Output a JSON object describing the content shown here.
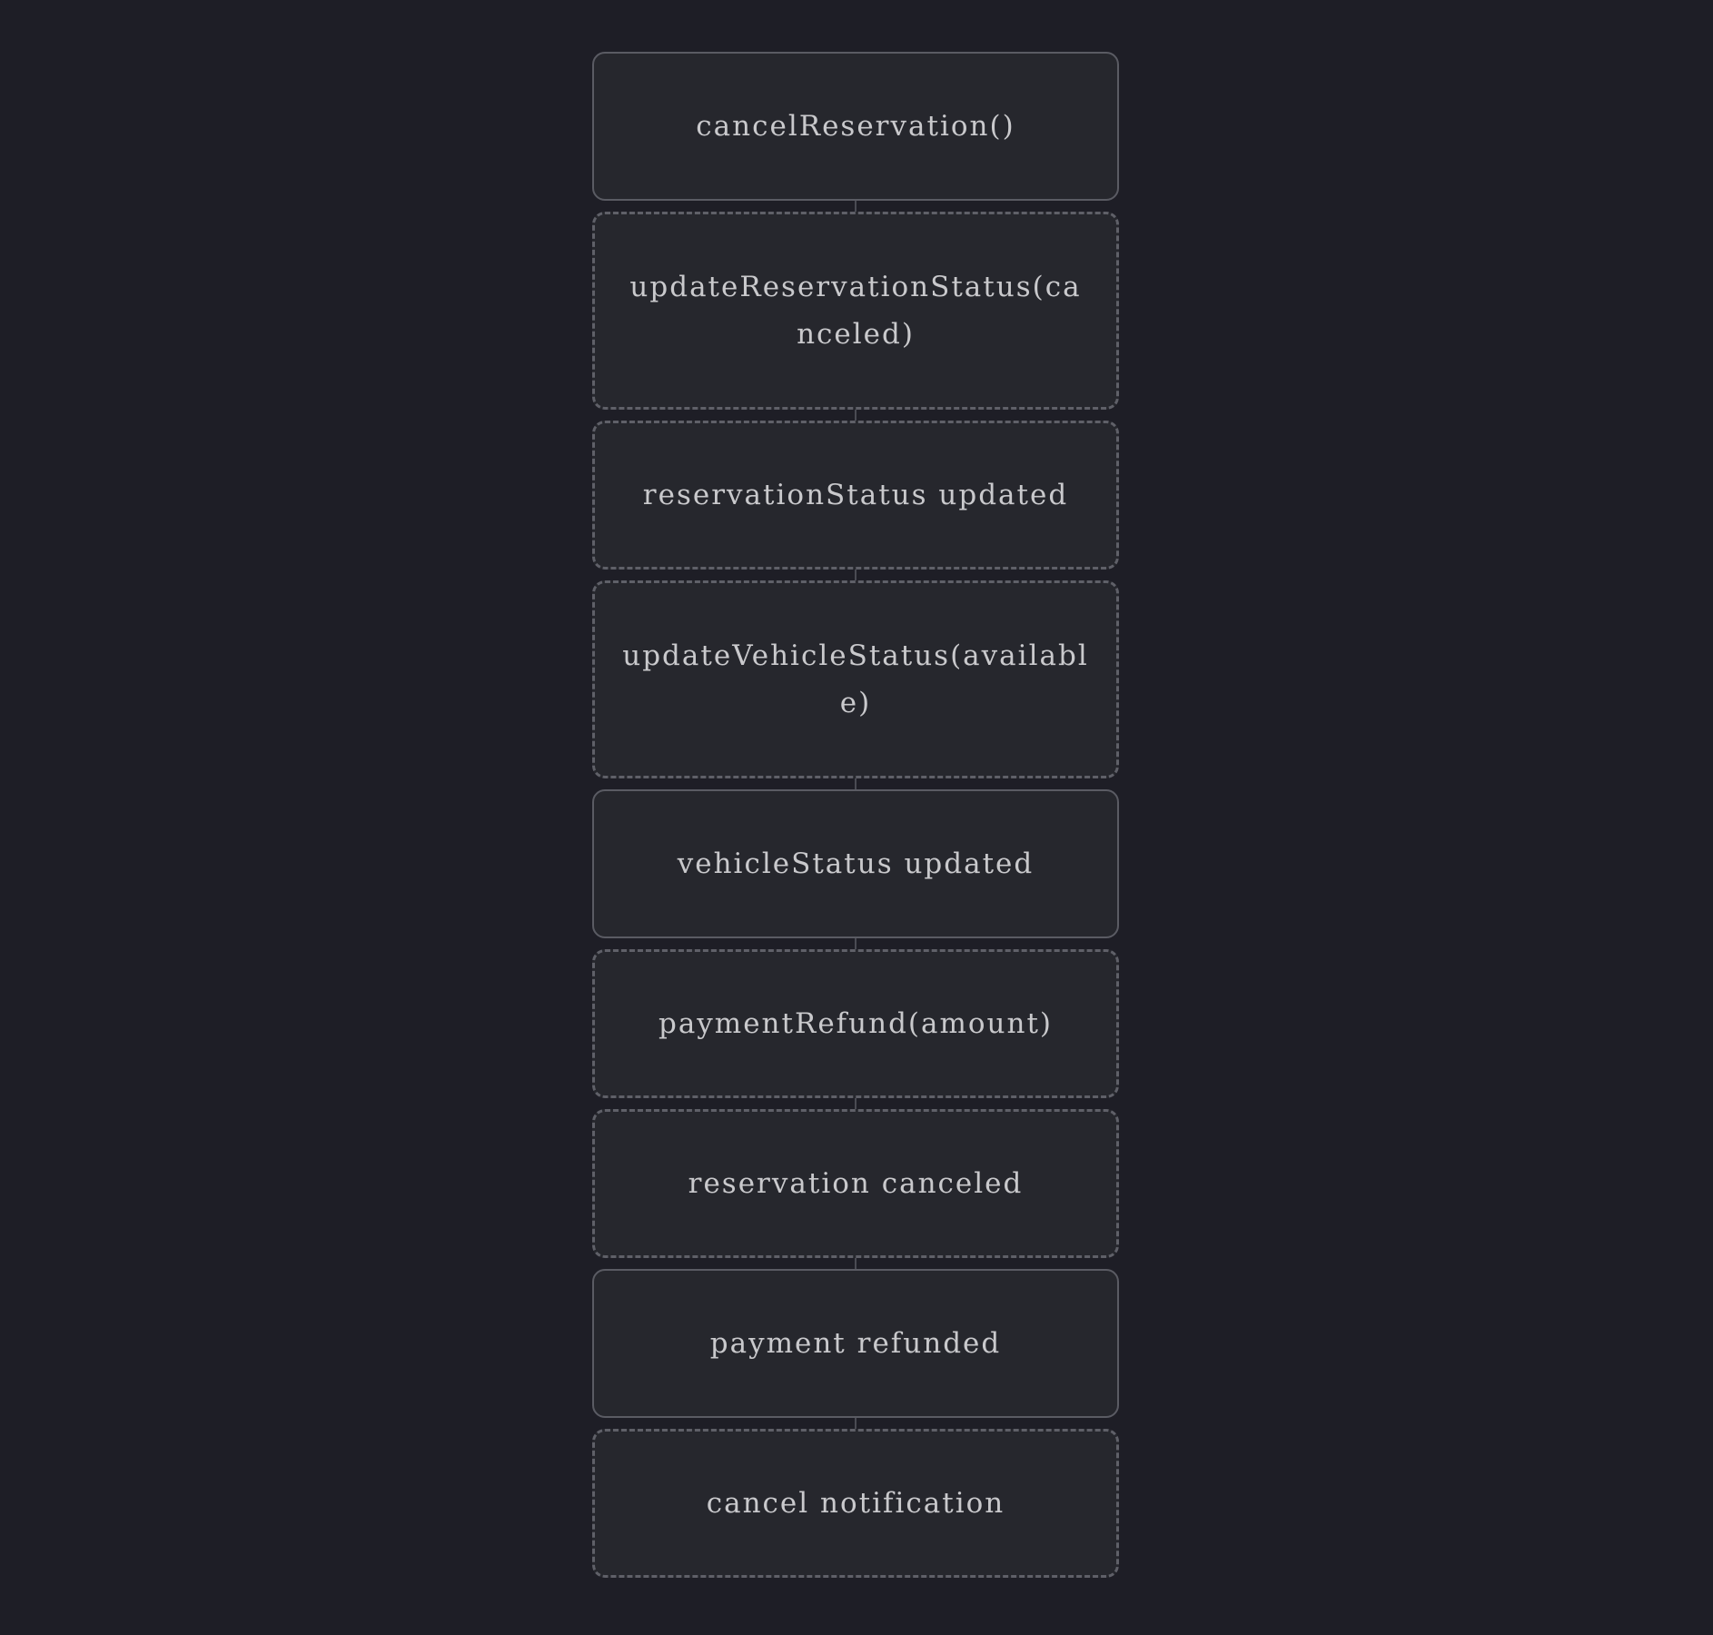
{
  "diagram": {
    "nodes": [
      {
        "label": "cancelReservation()",
        "style": "solid"
      },
      {
        "label": "updateReservationStatus(canceled)",
        "style": "dashed"
      },
      {
        "label": "reservationStatus updated",
        "style": "dashed"
      },
      {
        "label": "updateVehicleStatus(available)",
        "style": "dashed"
      },
      {
        "label": "vehicleStatus updated",
        "style": "solid"
      },
      {
        "label": "paymentRefund(amount)",
        "style": "dashed"
      },
      {
        "label": "reservation canceled",
        "style": "dashed"
      },
      {
        "label": "payment refunded",
        "style": "solid"
      },
      {
        "label": "cancel notification",
        "style": "dashed"
      }
    ]
  }
}
